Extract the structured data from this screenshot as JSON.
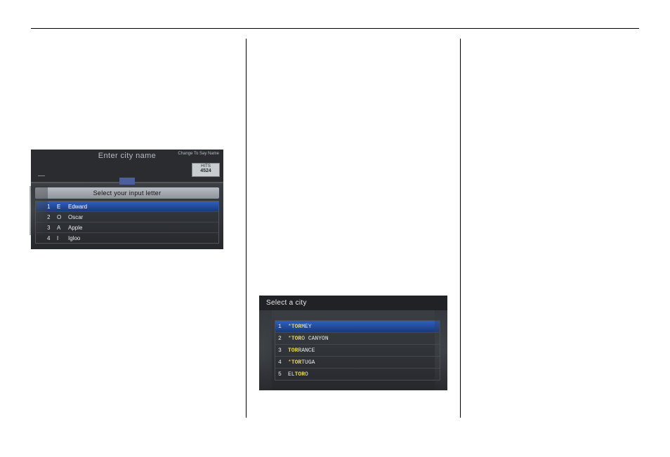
{
  "device1": {
    "title": "Enter city name",
    "change_label": "Change To\nSay Name",
    "hits_label": "HITS",
    "hits_value": "4524",
    "banner": "Select your input letter",
    "rows": [
      {
        "num": "1",
        "letter": "E",
        "word": "Edward"
      },
      {
        "num": "2",
        "letter": "O",
        "word": "Oscar"
      },
      {
        "num": "3",
        "letter": "A",
        "word": "Apple"
      },
      {
        "num": "4",
        "letter": "I",
        "word": "Igloo"
      }
    ]
  },
  "device2": {
    "title": "Select a city",
    "rows": [
      {
        "num": "1",
        "star": "*",
        "match": "TOR",
        "rest": "MEY"
      },
      {
        "num": "2",
        "star": "*",
        "match": "TOR",
        "rest": "O CANYON"
      },
      {
        "num": "3",
        "star": "",
        "match": "TOR",
        "rest": "RANCE"
      },
      {
        "num": "4",
        "star": "*",
        "match": "TOR",
        "rest": "TUGA"
      },
      {
        "num": "5",
        "star": "",
        "pre": "EL ",
        "match": "TOR",
        "rest": "O"
      }
    ]
  }
}
